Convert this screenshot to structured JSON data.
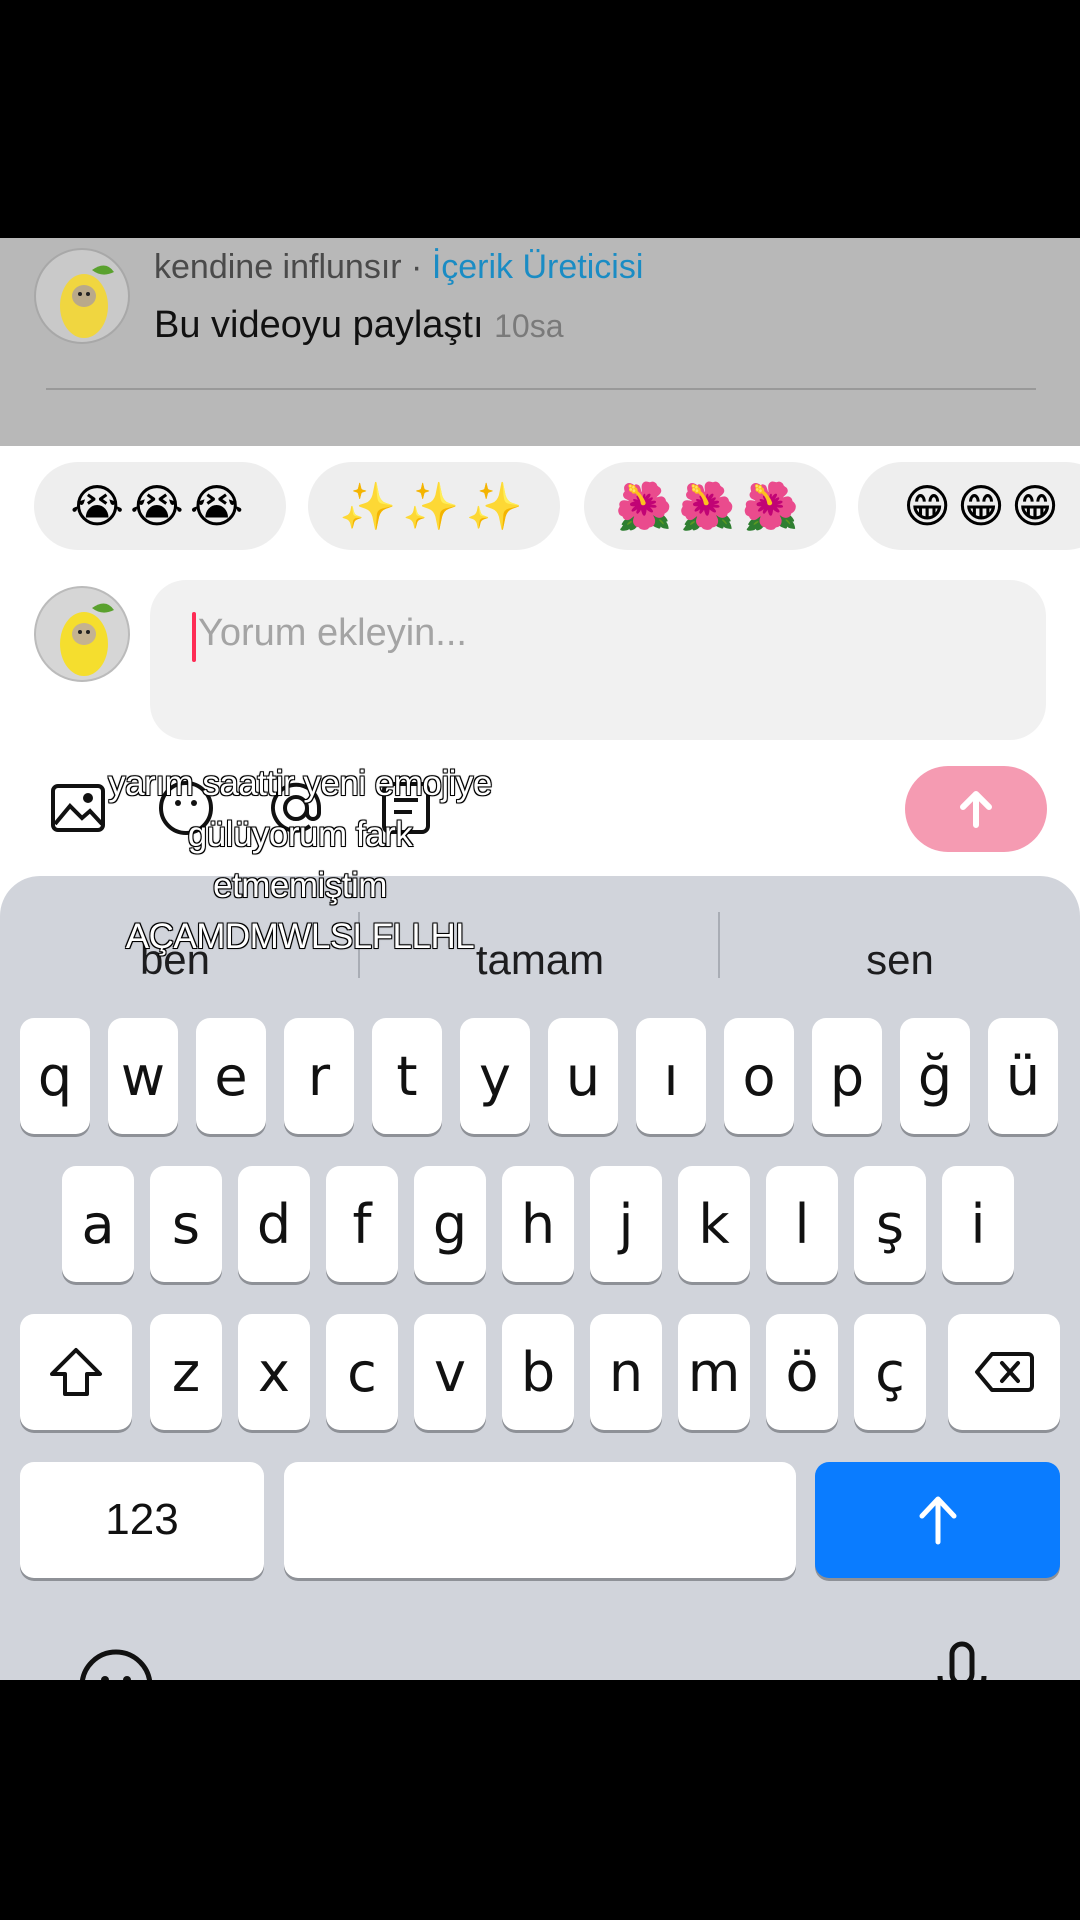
{
  "share": {
    "username": "kendine influnsır",
    "separator": " · ",
    "role": "İçerik Üreticisi",
    "action": "Bu videoyu paylaştı",
    "time": "10sa"
  },
  "reactions": [
    "😭😭😭",
    "✨✨✨",
    "🌺🌺🌺",
    "😁😁😁"
  ],
  "comment": {
    "placeholder": "Yorum ekleyin..."
  },
  "caption": {
    "lines": [
      "yarım saattir yeni emojiye",
      "gülüyorum fark",
      "etmemiştim",
      "AÇAMDMWLSLFLLHL"
    ]
  },
  "keyboard": {
    "suggestions": [
      "ben",
      "tamam",
      "sen"
    ],
    "row1": [
      "q",
      "w",
      "e",
      "r",
      "t",
      "y",
      "u",
      "ı",
      "o",
      "p",
      "ğ",
      "ü"
    ],
    "row2": [
      "a",
      "s",
      "d",
      "f",
      "g",
      "h",
      "j",
      "k",
      "l",
      "ş",
      "i"
    ],
    "row3": [
      "z",
      "x",
      "c",
      "v",
      "b",
      "n",
      "m",
      "ö",
      "ç"
    ],
    "numbers_label": "123"
  },
  "colors": {
    "accent_pink": "#fe2c55",
    "send_button": "#f59bb2",
    "keyboard_return": "#0a7cff",
    "creator_blue": "#1a8cc4"
  },
  "icons": [
    "image-icon",
    "emoji-icon",
    "mention-icon",
    "list-icon",
    "send-arrow-icon",
    "shift-icon",
    "backspace-icon",
    "return-arrow-icon",
    "emoji-keyboard-icon",
    "microphone-icon"
  ]
}
